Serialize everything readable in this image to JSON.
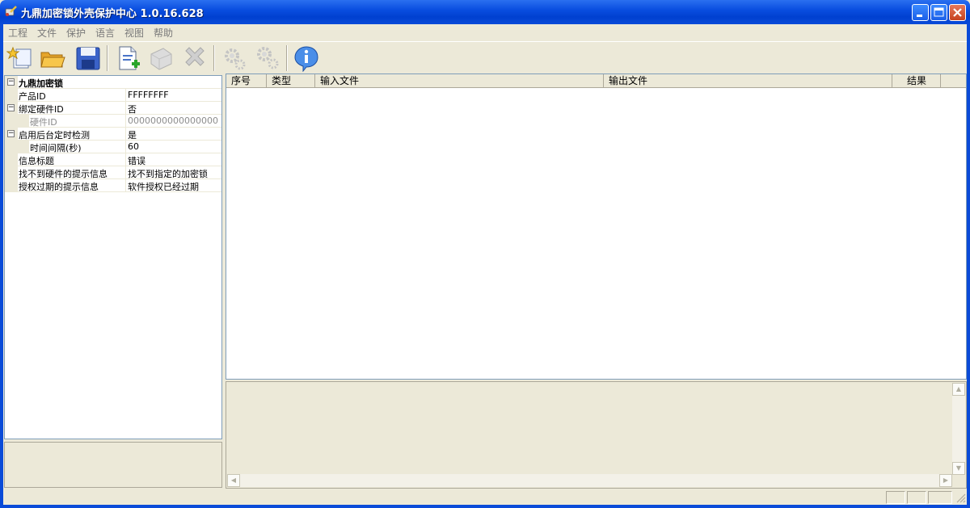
{
  "window": {
    "title": "九鼎加密锁外壳保护中心 1.0.16.628"
  },
  "menu": [
    {
      "label": "工程"
    },
    {
      "label": "文件"
    },
    {
      "label": "保护"
    },
    {
      "label": "语言"
    },
    {
      "label": "视图"
    },
    {
      "label": "帮助"
    }
  ],
  "toolbar": {
    "buttons": [
      {
        "icon": "new-project-icon",
        "enabled": true
      },
      {
        "icon": "open-folder-icon",
        "enabled": true
      },
      {
        "icon": "save-disk-icon",
        "enabled": true
      },
      {
        "icon": "add-file-icon",
        "enabled": true
      },
      {
        "icon": "file-properties-icon",
        "enabled": false
      },
      {
        "icon": "delete-x-icon",
        "enabled": false
      },
      {
        "icon": "protect-gear-icon",
        "enabled": false
      },
      {
        "icon": "protect-all-gears-icon",
        "enabled": false
      },
      {
        "icon": "about-info-icon",
        "enabled": true
      }
    ]
  },
  "properties": [
    {
      "key": "九鼎加密锁",
      "value": "",
      "level": 0,
      "expander": "⊟",
      "bold": true
    },
    {
      "key": "产品ID",
      "value": "FFFFFFFF",
      "level": 1,
      "expander": ""
    },
    {
      "key": "绑定硬件ID",
      "value": "否",
      "level": 0,
      "expander": "⊟"
    },
    {
      "key": "硬件ID",
      "value": "0000000000000000",
      "level": 2,
      "expander": "",
      "disabled": true
    },
    {
      "key": "启用后台定时检测",
      "value": "是",
      "level": 0,
      "expander": "⊟"
    },
    {
      "key": "时间间隔(秒)",
      "value": "60",
      "level": 2,
      "expander": ""
    },
    {
      "key": "信息标题",
      "value": "错误",
      "level": 1,
      "expander": ""
    },
    {
      "key": "找不到硬件的提示信息",
      "value": "找不到指定的加密锁",
      "level": 1,
      "expander": ""
    },
    {
      "key": "授权过期的提示信息",
      "value": "软件授权已经过期",
      "level": 1,
      "expander": ""
    }
  ],
  "file_list": {
    "columns": [
      {
        "label": "序号"
      },
      {
        "label": "类型"
      },
      {
        "label": "输入文件"
      },
      {
        "label": "输出文件"
      },
      {
        "label": "结果"
      }
    ],
    "rows": []
  },
  "colors": {
    "title_bar": "#0a4bd8",
    "window_bg": "#ece9d8",
    "disabled_text": "#8c8c8c"
  }
}
